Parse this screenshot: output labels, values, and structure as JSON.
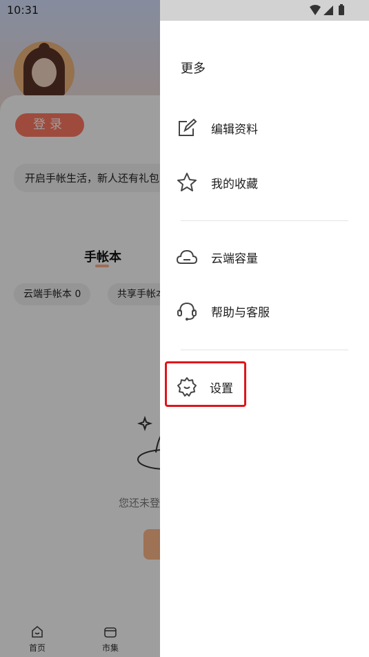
{
  "status_bar": {
    "time": "10:31"
  },
  "background": {
    "login_label": "登录",
    "promo_text": "开启手帐生活，新人还有礼包",
    "section_title": "手帐本",
    "chips": [
      "云端手帐本 0",
      "共享手帐本"
    ],
    "empty_text": "您还未登录",
    "tabs": [
      {
        "label": "首页",
        "icon": "home-icon"
      },
      {
        "label": "市集",
        "icon": "market-icon"
      }
    ]
  },
  "drawer": {
    "title": "更多",
    "items": [
      {
        "label": "编辑资料",
        "icon": "edit-icon"
      },
      {
        "label": "我的收藏",
        "icon": "star-icon"
      },
      {
        "label": "云端容量",
        "icon": "cloud-icon"
      },
      {
        "label": "帮助与客服",
        "icon": "headset-icon"
      },
      {
        "label": "设置",
        "icon": "gear-icon"
      }
    ],
    "highlight_color": "#e0141a"
  }
}
